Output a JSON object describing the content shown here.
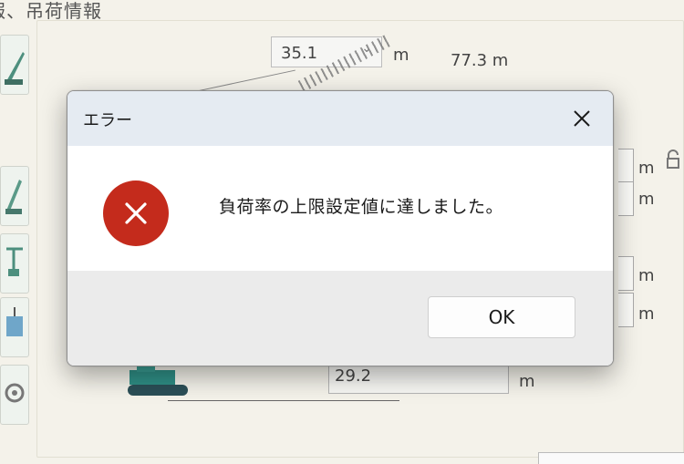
{
  "background": {
    "section_title": "報、吊荷情報",
    "boom_combo_value": "35.1",
    "boom_combo_unit": "m",
    "radius_value": "77.3 m",
    "field_value": "29.2",
    "field_unit": "m",
    "right_units": [
      "m",
      "m",
      "m",
      "m"
    ]
  },
  "dialog": {
    "title": "エラー",
    "message": "負荷率の上限設定値に達しました。",
    "ok_label": "OK",
    "icon": "error-icon",
    "colors": {
      "error_red": "#c42b1c",
      "titlebar": "#e5ebf2",
      "footer": "#ebebeb"
    }
  }
}
